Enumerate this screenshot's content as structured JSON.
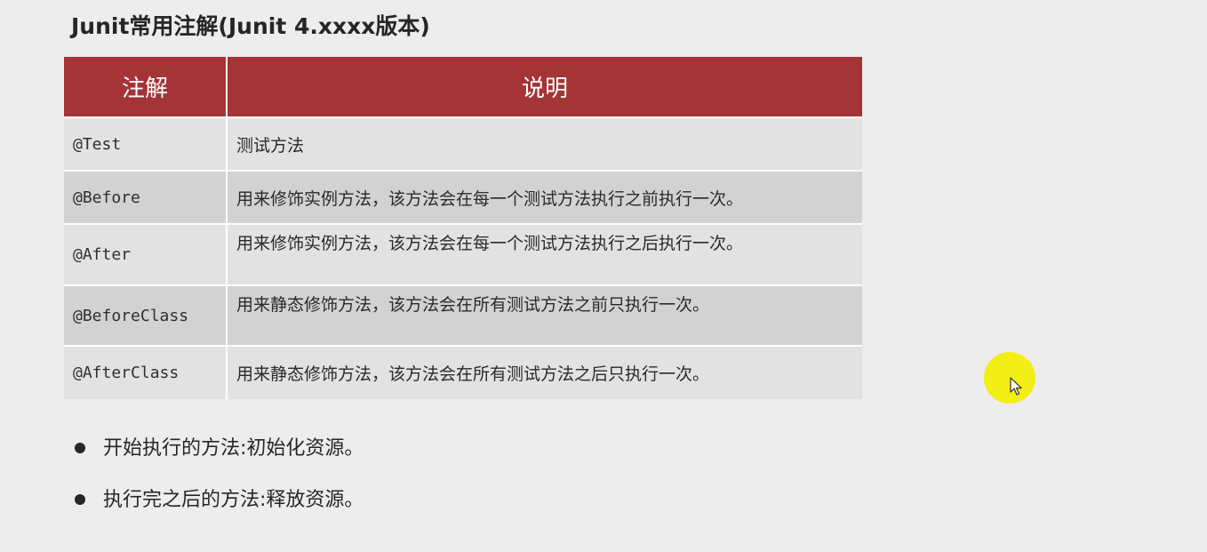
{
  "title": "Junit常用注解(Junit 4.xxxx版本)",
  "table": {
    "headers": [
      "注解",
      "说明"
    ],
    "rows": [
      {
        "annotation": "@Test",
        "description": "测试方法"
      },
      {
        "annotation": "@Before",
        "description": "用来修饰实例方法，该方法会在每一个测试方法执行之前执行一次。"
      },
      {
        "annotation": "@After",
        "description": "用来修饰实例方法，该方法会在每一个测试方法执行之后执行一次。"
      },
      {
        "annotation": "@BeforeClass",
        "description": "用来静态修饰方法，该方法会在所有测试方法之前只执行一次。"
      },
      {
        "annotation": "@AfterClass",
        "description": "用来静态修饰方法，该方法会在所有测试方法之后只执行一次。"
      }
    ]
  },
  "bullets": [
    "开始执行的方法:初始化资源。",
    "执行完之后的方法:释放资源。"
  ],
  "colors": {
    "header_background": "#a43436",
    "row_light": "#e3e2e3",
    "row_dark": "#d3d2d3",
    "cursor_highlight": "#f2ee16"
  },
  "icons": {
    "cursor": "mouse-pointer-icon"
  }
}
